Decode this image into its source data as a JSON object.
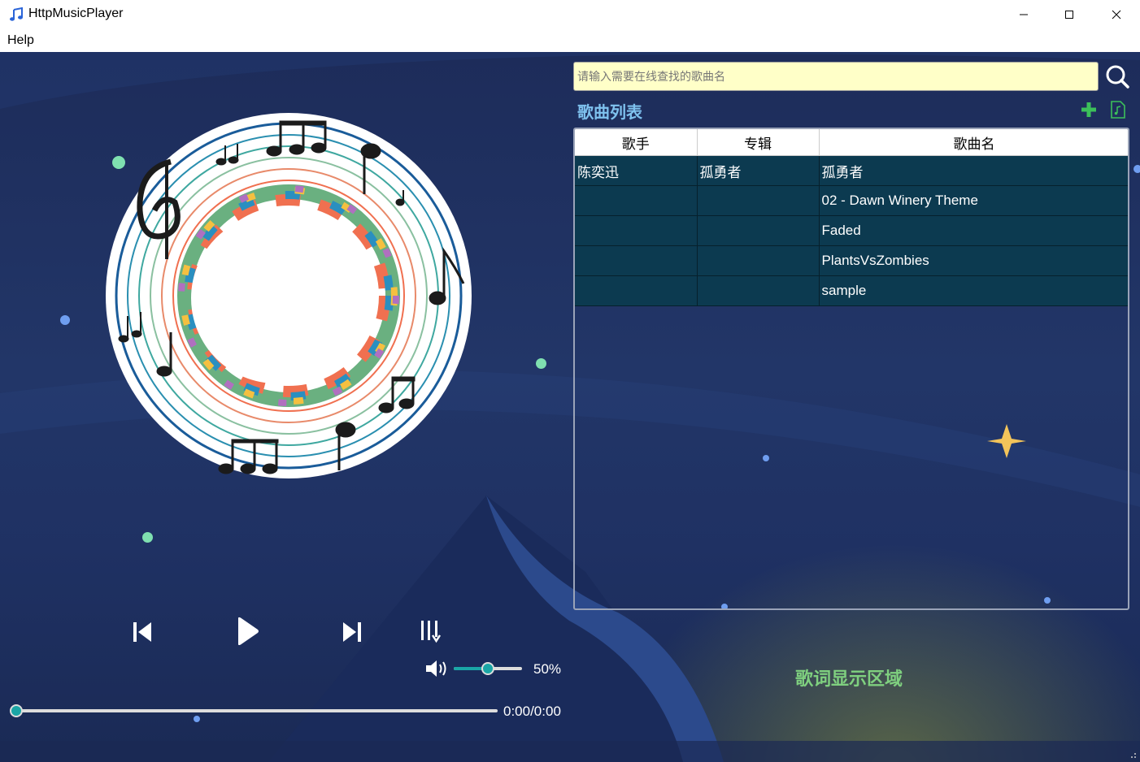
{
  "window": {
    "title": "HttpMusicPlayer"
  },
  "menu": {
    "help": "Help"
  },
  "search": {
    "placeholder": "请输入需要在线查找的歌曲名"
  },
  "playlist": {
    "title": "歌曲列表",
    "columns": [
      "歌手",
      "专辑",
      "歌曲名"
    ],
    "rows": [
      [
        "陈奕迅",
        "孤勇者",
        "孤勇者"
      ],
      [
        "",
        "",
        "02 - Dawn Winery Theme"
      ],
      [
        "",
        "",
        "Faded"
      ],
      [
        "",
        "",
        "PlantsVsZombies"
      ],
      [
        "",
        "",
        "sample"
      ]
    ]
  },
  "player": {
    "volume_label": "50%",
    "volume": 0.5,
    "time": "0:00/0:00",
    "progress": 0
  },
  "lyrics": {
    "placeholder": "歌词显示区域"
  },
  "colors": {
    "accent": "#1aa6a6",
    "list_title": "#7fc2ef",
    "lyrics": "#7fd07f",
    "row_bg": "#0c3a50",
    "search_bg": "#ffffc8"
  }
}
